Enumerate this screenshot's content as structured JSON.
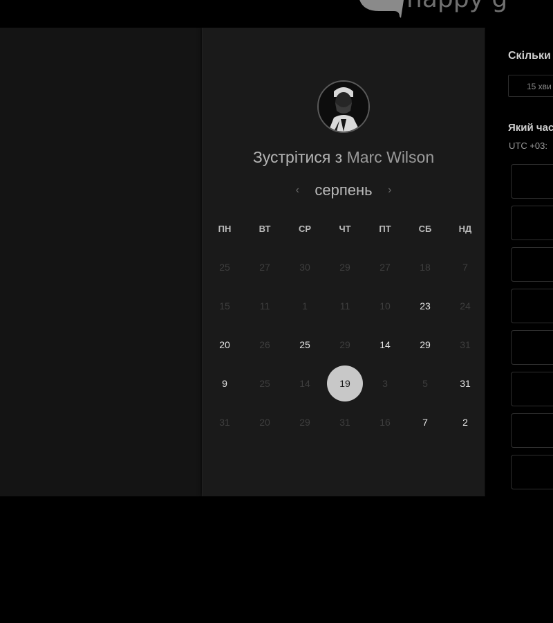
{
  "brand": {
    "name": "happy g",
    "logo_icon": "chat-bubble-logo-icon"
  },
  "booking": {
    "title_prefix": "Зустрітися з",
    "host_name": "Marc Wilson",
    "avatar_icon": "user-avatar-icon",
    "month": "серпень",
    "prev_icon": "chevron-left-icon",
    "next_icon": "chevron-right-icon",
    "weekdays": [
      "ПН",
      "ВТ",
      "СР",
      "ЧТ",
      "ПТ",
      "СБ",
      "НД"
    ],
    "weeks": [
      [
        {
          "d": "25",
          "a": false
        },
        {
          "d": "27",
          "a": false
        },
        {
          "d": "30",
          "a": false
        },
        {
          "d": "29",
          "a": false
        },
        {
          "d": "27",
          "a": false
        },
        {
          "d": "18",
          "a": false
        },
        {
          "d": "7",
          "a": false
        }
      ],
      [
        {
          "d": "15",
          "a": false
        },
        {
          "d": "11",
          "a": false
        },
        {
          "d": "1",
          "a": false
        },
        {
          "d": "11",
          "a": false
        },
        {
          "d": "10",
          "a": false
        },
        {
          "d": "23",
          "a": true
        },
        {
          "d": "24",
          "a": false
        }
      ],
      [
        {
          "d": "20",
          "a": true
        },
        {
          "d": "26",
          "a": false
        },
        {
          "d": "25",
          "a": true
        },
        {
          "d": "29",
          "a": false
        },
        {
          "d": "14",
          "a": true
        },
        {
          "d": "29",
          "a": true
        },
        {
          "d": "31",
          "a": false
        }
      ],
      [
        {
          "d": "9",
          "a": true
        },
        {
          "d": "25",
          "a": false
        },
        {
          "d": "14",
          "a": false
        },
        {
          "d": "19",
          "a": true,
          "selected": true
        },
        {
          "d": "3",
          "a": false
        },
        {
          "d": "5",
          "a": false
        },
        {
          "d": "31",
          "a": true
        }
      ],
      [
        {
          "d": "31",
          "a": false
        },
        {
          "d": "20",
          "a": false
        },
        {
          "d": "29",
          "a": false
        },
        {
          "d": "31",
          "a": false
        },
        {
          "d": "16",
          "a": false
        },
        {
          "d": "7",
          "a": true
        },
        {
          "d": "2",
          "a": true
        }
      ]
    ]
  },
  "side": {
    "duration_title": "Скільки",
    "duration_value": "15 хви",
    "time_title": "Який час",
    "timezone": "UTC +03:"
  },
  "colors": {
    "selected_day_bg": "#c8c8c8",
    "card_bg": "#1a1a1a",
    "page_bg": "#141414"
  }
}
